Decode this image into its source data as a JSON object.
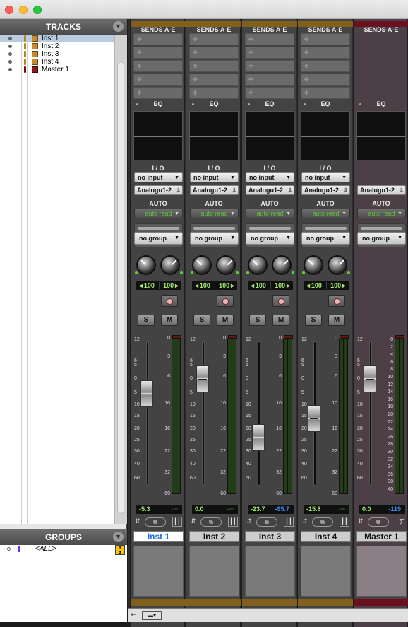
{
  "tracks_panel": {
    "title": "TRACKS",
    "items": [
      {
        "name": "Inst 1",
        "selected": true,
        "kind": "instrument"
      },
      {
        "name": "Inst 2",
        "selected": false,
        "kind": "instrument"
      },
      {
        "name": "Inst 3",
        "selected": false,
        "kind": "instrument"
      },
      {
        "name": "Inst 4",
        "selected": false,
        "kind": "instrument"
      },
      {
        "name": "Master 1",
        "selected": false,
        "kind": "master"
      }
    ]
  },
  "groups_panel": {
    "title": "GROUPS",
    "items": [
      {
        "id": "!",
        "name": "<ALL>"
      }
    ],
    "sort_icon": "az-sort-icon"
  },
  "labels": {
    "sends": "SENDS A-E",
    "eq": "EQ",
    "io": "I / O",
    "auto": "AUTO",
    "insert_slot": "✤"
  },
  "channels": [
    {
      "name": "Inst 1",
      "input": "no input",
      "output": "Analogu1-2",
      "automation": "auto read",
      "group": "no group",
      "pan_l": "◄100",
      "pan_r": "100►",
      "solo": "S",
      "mute": "M",
      "volume": "-5.3",
      "peak": "-∞",
      "volume_db": -5.3,
      "active": true
    },
    {
      "name": "Inst 2",
      "input": "no input",
      "output": "Analogu1-2",
      "automation": "auto read",
      "group": "no group",
      "pan_l": "◄100",
      "pan_r": "100►",
      "solo": "S",
      "mute": "M",
      "volume": "0.0",
      "peak": "-∞",
      "volume_db": 0,
      "active": false
    },
    {
      "name": "Inst 3",
      "input": "no input",
      "output": "Analogu1-2",
      "automation": "auto read",
      "group": "no group",
      "pan_l": "◄100",
      "pan_r": "100►",
      "solo": "S",
      "mute": "M",
      "volume": "-23.7",
      "peak": "-95.7",
      "volume_db": -23.7,
      "active": false
    },
    {
      "name": "Inst 4",
      "input": "no input",
      "output": "Analogu1-2",
      "automation": "auto read",
      "group": "no group",
      "pan_l": "◄100",
      "pan_r": "100►",
      "solo": "S",
      "mute": "M",
      "volume": "-15.8",
      "peak": "-∞",
      "volume_db": -15.8,
      "active": false
    },
    {
      "name": "Master 1",
      "output": "Analogu1-2",
      "automation": "auto read",
      "group": "no group",
      "volume": "0.0",
      "peak": "-119",
      "volume_db": 0,
      "master": true
    }
  ],
  "fader_scale": [
    "12",
    "6",
    "5",
    "0",
    "5",
    "10",
    "15",
    "20",
    "25",
    "30",
    "40",
    "60"
  ],
  "meter_scale": [
    "0",
    "3",
    "6",
    "10",
    "16",
    "22",
    "32",
    "60"
  ],
  "master_meter_scale": [
    "0",
    "2",
    "4",
    "6",
    "8",
    "10",
    "12",
    "14",
    "16",
    "18",
    "20",
    "22",
    "24",
    "26",
    "28",
    "30",
    "32",
    "34",
    "36",
    "38",
    "40"
  ],
  "colors": {
    "track_color": "#b3861d",
    "master_color": "#800000",
    "selection": "#b8cbe0"
  },
  "bottom_tools": {
    "narrow": "⇤",
    "view": "▬▾"
  }
}
